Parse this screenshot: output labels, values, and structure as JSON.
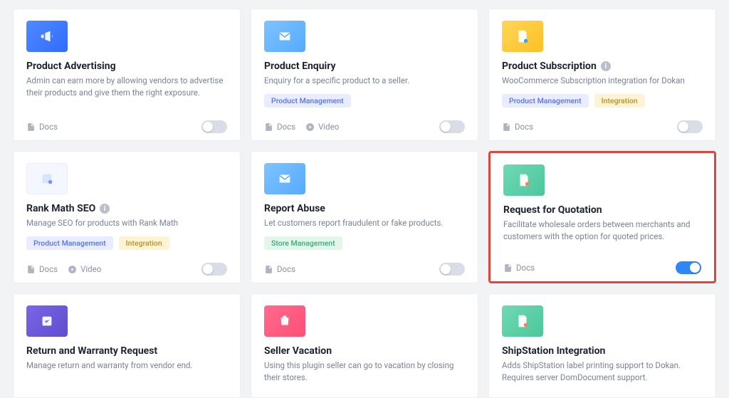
{
  "tags": {
    "pm": "Product Management",
    "int": "Integration",
    "sm": "Store Management"
  },
  "labels": {
    "docs": "Docs",
    "video": "Video"
  },
  "cards": [
    {
      "id": "product-advertising",
      "title": "Product Advertising",
      "desc": "Admin can earn more by allowing vendors to advertise their products and give them the right exposure.",
      "thumb": "blue",
      "info": false,
      "tags": [],
      "video": false,
      "enabled": false,
      "highlight": false
    },
    {
      "id": "product-enquiry",
      "title": "Product Enquiry",
      "desc": "Enquiry for a specific product to a seller.",
      "thumb": "lblue",
      "info": false,
      "tags": [
        "pm"
      ],
      "video": true,
      "enabled": false,
      "highlight": false
    },
    {
      "id": "product-subscription",
      "title": "Product Subscription",
      "desc": "WooCommerce Subscription integration for Dokan",
      "thumb": "yellow",
      "info": true,
      "tags": [
        "pm",
        "int"
      ],
      "video": false,
      "enabled": false,
      "highlight": false
    },
    {
      "id": "rank-math-seo",
      "title": "Rank Math SEO",
      "desc": "Manage SEO for products with Rank Math",
      "thumb": "white",
      "info": true,
      "tags": [
        "pm",
        "int"
      ],
      "video": true,
      "enabled": false,
      "highlight": false
    },
    {
      "id": "report-abuse",
      "title": "Report Abuse",
      "desc": "Let customers report fraudulent or fake products.",
      "thumb": "lblue",
      "info": false,
      "tags": [
        "sm"
      ],
      "video": false,
      "enabled": false,
      "highlight": false
    },
    {
      "id": "request-for-quotation",
      "title": "Request for Quotation",
      "desc": "Facilitate wholesale orders between merchants and customers with the option for quoted prices.",
      "thumb": "teal",
      "info": false,
      "tags": [],
      "video": false,
      "enabled": true,
      "highlight": true
    },
    {
      "id": "return-and-warranty",
      "title": "Return and Warranty Request",
      "desc": "Manage return and warranty from vendor end.",
      "thumb": "violet",
      "info": false,
      "tags": [],
      "video": false,
      "short": true
    },
    {
      "id": "seller-vacation",
      "title": "Seller Vacation",
      "desc": "Using this plugin seller can go to vacation by closing their stores.",
      "thumb": "pink",
      "info": false,
      "tags": [],
      "video": false,
      "short": true
    },
    {
      "id": "shipstation-integration",
      "title": "ShipStation Integration",
      "desc": "Adds ShipStation label printing support to Dokan. Requires server DomDocument support.",
      "thumb": "teal",
      "info": false,
      "tags": [],
      "video": false,
      "short": true
    }
  ]
}
